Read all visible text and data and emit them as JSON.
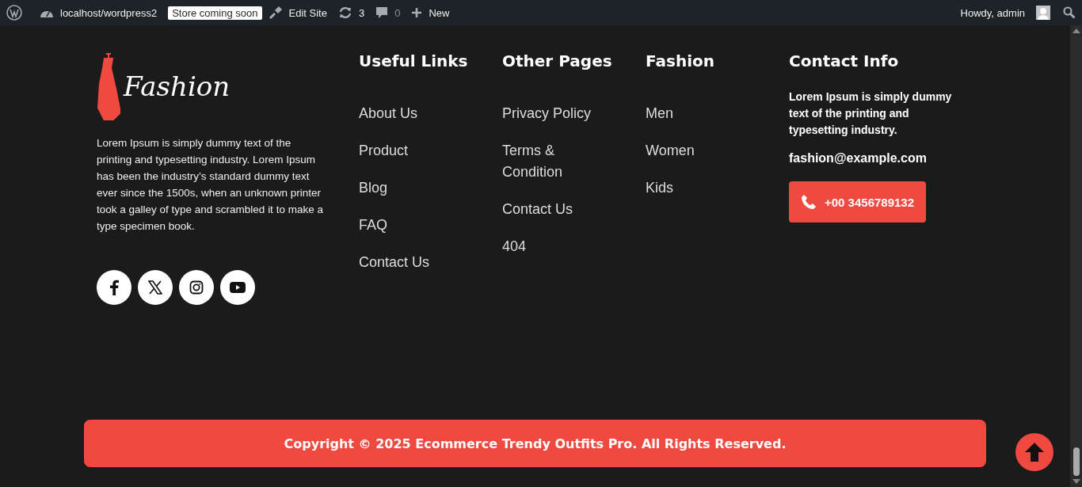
{
  "admin_bar": {
    "site": "localhost/wordpress2",
    "badge": "Store coming soon",
    "edit": "Edit Site",
    "updates": "3",
    "comments": "0",
    "new": "New",
    "greeting": "Howdy, admin"
  },
  "footer": {
    "logo_text": "Fashion",
    "about": "Lorem Ipsum is simply dummy text of the printing and typesetting industry. Lorem Ipsum has been the industry’s standard dummy text ever since the 1500s, when an unknown printer took a galley of type and scrambled it to make a type specimen book.",
    "social": [
      {
        "kind": "facebook"
      },
      {
        "kind": "x"
      },
      {
        "kind": "instagram"
      },
      {
        "kind": "youtube"
      }
    ],
    "columns": [
      {
        "title": "Useful Links",
        "links": [
          "About Us",
          "Product",
          "Blog",
          "FAQ",
          "Contact Us"
        ]
      },
      {
        "title": "Other Pages",
        "links": [
          "Privacy Policy",
          "Terms & Condition",
          "Contact Us",
          "404"
        ]
      },
      {
        "title": "Fashion",
        "links": [
          "Men",
          "Women",
          "Kids"
        ]
      }
    ],
    "contact": {
      "title": "Contact Info",
      "text": "Lorem Ipsum is simply dummy text of the printing and typesetting industry.",
      "email": "fashion@example.com",
      "phone": "+00 3456789132"
    },
    "copyright": "Copyright © 2025 Ecommerce Trendy Outfits Pro. All Rights Reserved."
  }
}
